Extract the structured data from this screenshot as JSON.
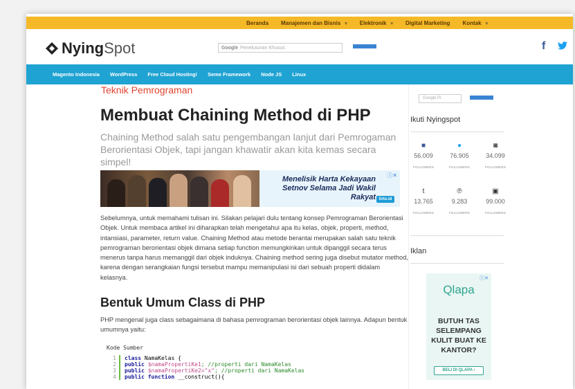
{
  "topbar": {
    "items": [
      {
        "label": "Beranda",
        "dropdown": false
      },
      {
        "label": "Manajemen dan Bisnis",
        "dropdown": true
      },
      {
        "label": "Elektronik",
        "dropdown": true
      },
      {
        "label": "Digital Marketing",
        "dropdown": false
      },
      {
        "label": "Kontak",
        "dropdown": true
      }
    ],
    "color": "#f5b928"
  },
  "header": {
    "logo_bold": "Nying",
    "logo_light": "Spot",
    "search_brand": "Google",
    "search_placeholder": "Penelusuran Khusus",
    "facebook_glyph": "f",
    "twitter_glyph": "🐦"
  },
  "bluenav": {
    "color": "#1fa3d2",
    "items": [
      "Magento Indonesia",
      "WordPress",
      "Free Cloud Hosting!",
      "Seme Framework",
      "Node JS",
      "Linux"
    ]
  },
  "article": {
    "category": "Teknik Pemrograman",
    "title": "Membuat Chaining Method di PHP",
    "subtitle": "Chaining Method salah satu pengembangan lanjut dari Pemrogaman Berorientasi Objek, tapi jangan khawatir akan kita kemas secara simpel!",
    "ad": {
      "headline": "Menelisik Harta Kekayaan Setnov Selama Jadi Wakil Rakyat",
      "brand": "tirto.id"
    },
    "paragraph1": "Sebelumnya, untuk memahami tulisan ini. Silakan pelajari dulu tentang konsep Pemrograman Berorientasi Objek. Untuk membaca artikel ini diharapkan telah mengetahui apa itu kelas, objek, properti, method, intansiasi, parameter, return value. Chaining Method atau metode berantai merupakan salah satu teknik pemrograman berorientasi objek dimana setiap function memungkinkan untuk dipanggil secara terus menerus tanpa harus memanggil dari objek induknya. Chaining method sering juga disebut mutator method, karena dengan serangkaian fungsi tersebut mampu memanipulasi isi dari sebuah properti didalam kelasnya.",
    "heading2": "Bentuk Umum Class di PHP",
    "paragraph2": "PHP mengenal juga class sebagaimana di bahasa pemrograman berorientasi objek lainnya. Adapun bentuk umumnya yaitu:",
    "code_label": "Kode Sumber",
    "code_lines": [
      {
        "n": "1",
        "kw": "class",
        "rest": " NamaKelas {",
        "var": "",
        "comment": ""
      },
      {
        "n": "2",
        "kw": "public",
        "rest": " ",
        "var": "$namaPropertiKe1",
        "comment": "; //properti dari NamaKelas"
      },
      {
        "n": "3",
        "kw": "public",
        "rest": " ",
        "var": "$namaPropertiKe2=\"x\"",
        "comment": "; //properti dari NamaKelas"
      },
      {
        "n": "4",
        "kw": "public function",
        "rest": " __construct(){",
        "var": "",
        "comment": ""
      }
    ]
  },
  "sidebar": {
    "search_placeholder": "Google Pi",
    "follow_title": "Ikuti Nyingspot",
    "socials": [
      {
        "icon": "facebook-icon",
        "glyph": "■",
        "count": "56.009",
        "label": "FOLLOWERS",
        "color": "#3b5998"
      },
      {
        "icon": "twitter-icon",
        "glyph": "●",
        "count": "76.905",
        "label": "FOLLOWERS",
        "color": "#1da1f2"
      },
      {
        "icon": "instagram-icon",
        "glyph": "◙",
        "count": "34.099",
        "label": "FOLLOWERS",
        "color": "#444444"
      },
      {
        "icon": "tumblr-icon",
        "glyph": "t",
        "count": "13.765",
        "label": "FOLLOWERS",
        "color": "#333333"
      },
      {
        "icon": "pinterest-icon",
        "glyph": "℗",
        "count": "9.283",
        "label": "FOLLOWERS",
        "color": "#333333"
      },
      {
        "icon": "youtube-icon",
        "glyph": "▣",
        "count": "99.000",
        "label": "FOLLOWERS",
        "color": "#333333"
      }
    ],
    "ads_title": "Iklan",
    "qlapa": {
      "logo": "Qlapa",
      "text": "BUTUH TAS SELEMPANG KULIT BUAT KE KANTOR?",
      "button": "BELI DI QLAPA ›"
    }
  }
}
